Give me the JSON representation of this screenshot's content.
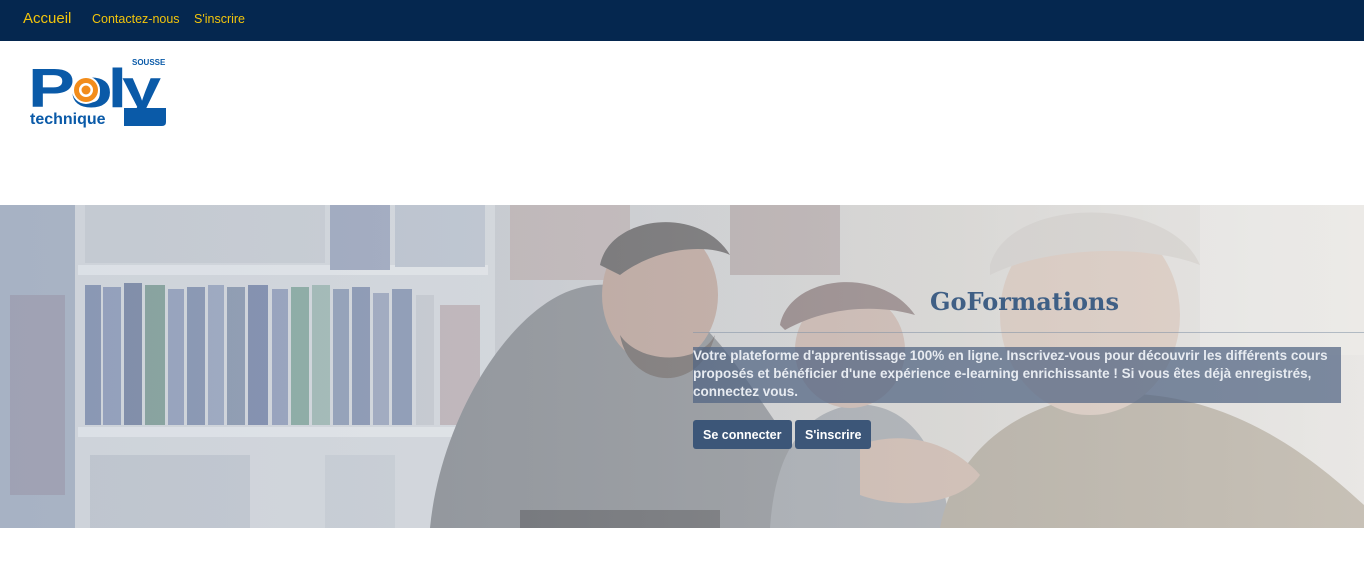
{
  "nav": {
    "brand": "Accueil",
    "links": [
      "Contactez-nous",
      "S'inscrire"
    ]
  },
  "logo": {
    "name": "Poly",
    "subtitle": "technique",
    "city": "SOUSSE"
  },
  "hero": {
    "title": "GoFormations",
    "description": "Votre plateforme d'apprentissage 100% en ligne. Inscrivez-vous pour découvrir les différents cours proposés et bénéficier d'une expérience e-learning enrichissante ! Si vous êtes déjà enregistrés, connectez vous.",
    "login_button": "Se connecter",
    "signup_button": "S'inscrire"
  },
  "colors": {
    "navbar": "#05274f",
    "nav_text": "#f2c40c",
    "logo_blue": "#0a5aa8",
    "logo_orange": "#f28c1a",
    "title": "#3f5f85",
    "button": "#3c5678"
  }
}
